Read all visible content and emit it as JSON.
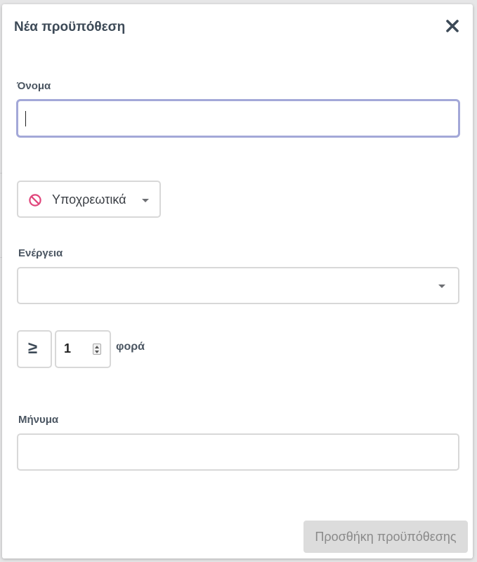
{
  "modal": {
    "title": "Νέα προϋπόθεση",
    "close_icon": "close-icon"
  },
  "name_field": {
    "label": "Όνομα",
    "value": "",
    "placeholder": ""
  },
  "mandatory": {
    "label": "Υποχρεωτικά",
    "icon": "forbidden-icon",
    "icon_color": "#e0457b"
  },
  "action": {
    "label": "Ενέργεια",
    "selected": ""
  },
  "count": {
    "operator": "≥",
    "value": "1",
    "unit": "φορά"
  },
  "message_field": {
    "label": "Μήνυμα",
    "value": "",
    "placeholder": ""
  },
  "footer": {
    "submit_label": "Προσθήκη προϋπόθεσης"
  },
  "colors": {
    "focus_border": "#a3a8d8",
    "title_text": "#3d4a57",
    "disabled_button_bg": "#dcdcdc"
  }
}
